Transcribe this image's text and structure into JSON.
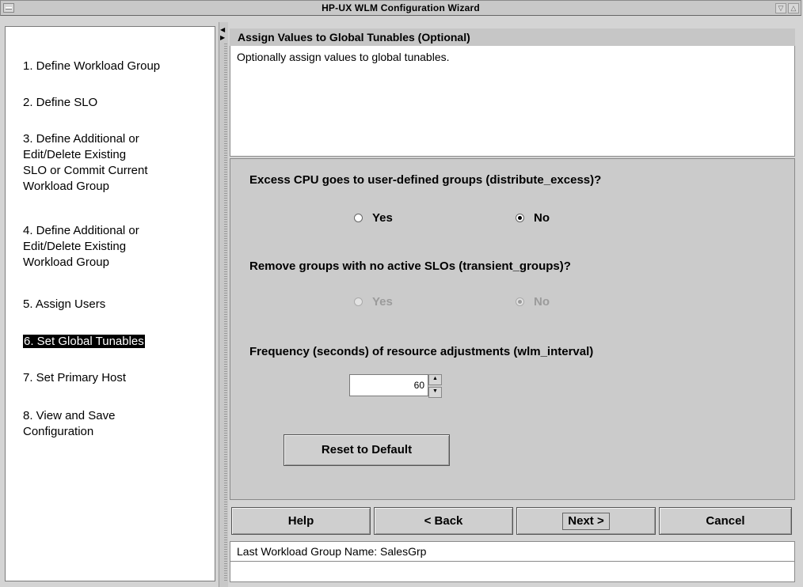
{
  "window": {
    "title": "HP-UX WLM Configuration Wizard",
    "minimize_glyph": "▽",
    "maximize_glyph": "△"
  },
  "steps": [
    {
      "label": "1. Define Workload Group"
    },
    {
      "label": "2. Define SLO"
    },
    {
      "label": "3. Define Additional or\n    Edit/Delete Existing\n    SLO or Commit Current\n    Workload Group"
    },
    {
      "label": "4. Define Additional or\n    Edit/Delete Existing\n    Workload Group"
    },
    {
      "label": "5. Assign Users"
    },
    {
      "label": "6. Set Global Tunables"
    },
    {
      "label": "7. Set Primary Host"
    },
    {
      "label": "8. View and Save\n    Configuration"
    }
  ],
  "active_step_index": 5,
  "page": {
    "header": "Assign Values to Global Tunables (Optional)",
    "description": "Optionally assign values to global tunables."
  },
  "tunables": {
    "distribute_excess": {
      "question": "Excess CPU goes to user-defined groups (distribute_excess)?",
      "options": {
        "yes": "Yes",
        "no": "No"
      },
      "selected": "No",
      "enabled": true
    },
    "transient_groups": {
      "question": "Remove groups with no active SLOs (transient_groups)?",
      "options": {
        "yes": "Yes",
        "no": "No"
      },
      "selected": "No",
      "enabled": false
    },
    "wlm_interval": {
      "question": "Frequency (seconds) of resource adjustments (wlm_interval)",
      "value": "60"
    },
    "reset_label": "Reset to Default"
  },
  "buttons": {
    "help": "Help",
    "back": "< Back",
    "next": "Next >",
    "cancel": "Cancel"
  },
  "status": {
    "last_group": "Last Workload Group Name: SalesGrp"
  }
}
